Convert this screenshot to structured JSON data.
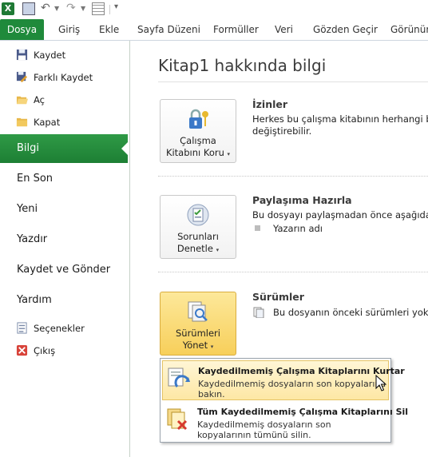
{
  "quick_access": {
    "app_icon": "excel-logo-icon",
    "app_icon_letter": "X",
    "save_icon": "save-icon",
    "undo_icon": "undo-icon",
    "redo_icon": "redo-icon",
    "form_icon": "form-icon",
    "customize_icon": "customize-toolbar-icon"
  },
  "ribbon_tabs": [
    {
      "label": "Dosya"
    },
    {
      "label": "Giriş"
    },
    {
      "label": "Ekle"
    },
    {
      "label": "Sayfa Düzeni"
    },
    {
      "label": "Formüller"
    },
    {
      "label": "Veri"
    },
    {
      "label": "Gözden Geçir"
    },
    {
      "label": "Görünüm"
    }
  ],
  "nav": {
    "commands": [
      {
        "label": "Kaydet",
        "icon": "save-icon"
      },
      {
        "label": "Farklı Kaydet",
        "icon": "save-as-icon"
      },
      {
        "label": "Aç",
        "icon": "open-folder-icon"
      },
      {
        "label": "Kapat",
        "icon": "close-folder-icon"
      }
    ],
    "sections": [
      {
        "label": "Bilgi",
        "selected": true
      },
      {
        "label": "En Son"
      },
      {
        "label": "Yeni"
      },
      {
        "label": "Yazdır"
      },
      {
        "label": "Kaydet ve Gönder"
      },
      {
        "label": "Yardım"
      }
    ],
    "bottom": [
      {
        "label": "Seçenekler",
        "icon": "options-icon"
      },
      {
        "label": "Çıkış",
        "icon": "exit-icon"
      }
    ]
  },
  "main": {
    "title": "Kitap1 hakkında bilgi",
    "permissions": {
      "button_line1": "Çalışma",
      "button_line2": "Kitabını Koru",
      "icon": "lock-key-icon",
      "heading": "İzinler",
      "line1": "Herkes bu çalışma kitabının herhangi bir b",
      "line2": "değiştirebilir."
    },
    "prepare": {
      "button_line1": "Sorunları",
      "button_line2": "Denetle",
      "icon": "inspect-document-icon",
      "heading": "Paylaşıma Hazırla",
      "line1": "Bu dosyayı paylaşmadan önce aşağıdakile",
      "bullet": "Yazarın adı"
    },
    "versions": {
      "button_line1": "Sürümleri",
      "button_line2": "Yönet",
      "icon": "manage-versions-icon",
      "heading": "Sürümler",
      "line1": "Bu dosyanın önceki sürümleri yok."
    }
  },
  "dropdown": {
    "items": [
      {
        "title": "Kaydedilmemiş Çalışma Kitaplarını Kurtar",
        "desc1": "Kaydedilmemiş dosyaların son kopyalarına",
        "desc2": "bakın.",
        "icon": "recover-unsaved-icon"
      },
      {
        "title": "Tüm Kaydedilmemiş Çalışma Kitaplarını Sil",
        "desc1": "Kaydedilmemiş dosyaların son",
        "desc2": "kopyalarının tümünü silin.",
        "icon": "delete-unsaved-icon"
      }
    ]
  },
  "colors": {
    "file_tab": "#1f8a3b",
    "selected_section": "#2a9240",
    "hover_button": "#f9d76e"
  }
}
